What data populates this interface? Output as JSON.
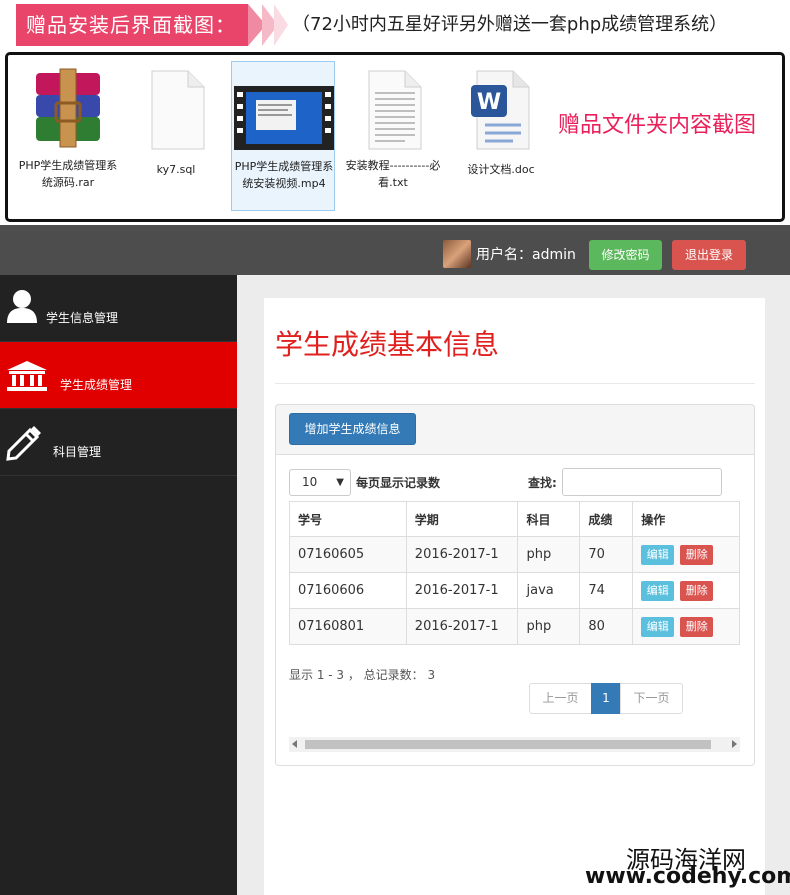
{
  "banner": {
    "tag": "赠品安装后界面截图：",
    "note": "（72小时内五星好评另外赠送一套php成绩管理系统）"
  },
  "files": [
    {
      "label": "PHP学生成绩管理系统源码.rar",
      "icon": "winrar-archive-icon"
    },
    {
      "label": "ky7.sql",
      "icon": "blank-document-icon"
    },
    {
      "label": "PHP学生成绩管理系统安装视频.mp4",
      "icon": "video-file-icon"
    },
    {
      "label": "安装教程----------必看.txt",
      "icon": "text-file-icon"
    },
    {
      "label": "设计文档.doc",
      "icon": "word-document-icon"
    }
  ],
  "folder_caption": "赠品文件夹内容截图",
  "topbar": {
    "username": "用户名：admin",
    "change_password": "修改密码",
    "logout": "退出登录"
  },
  "sidebar": {
    "items": [
      {
        "label": "学生信息管理",
        "icon": "user-icon",
        "active": false
      },
      {
        "label": "学生成绩管理",
        "icon": "institution-icon",
        "active": true
      },
      {
        "label": "科目管理",
        "icon": "pencil-icon",
        "active": false
      }
    ]
  },
  "main": {
    "title": "学生成绩基本信息",
    "add_button": "增加学生成绩信息",
    "page_size": "10",
    "per_page_label": "每页显示记录数",
    "search_label": "查找:",
    "columns": [
      "学号",
      "学期",
      "科目",
      "成绩",
      "操作"
    ],
    "rows": [
      {
        "id": "07160605",
        "term": "2016-2017-1",
        "subject": "php",
        "score": "70"
      },
      {
        "id": "07160606",
        "term": "2016-2017-1",
        "subject": "java",
        "score": "74"
      },
      {
        "id": "07160801",
        "term": "2016-2017-1",
        "subject": "php",
        "score": "80"
      }
    ],
    "edit_label": "编辑",
    "delete_label": "删除",
    "summary": "显示 1 - 3 ， 总记录数： 3",
    "pager": {
      "prev": "上一页",
      "current": "1",
      "next": "下一页"
    }
  },
  "watermark": {
    "line1": "源码海洋网",
    "line2": "www.codehy.com"
  }
}
